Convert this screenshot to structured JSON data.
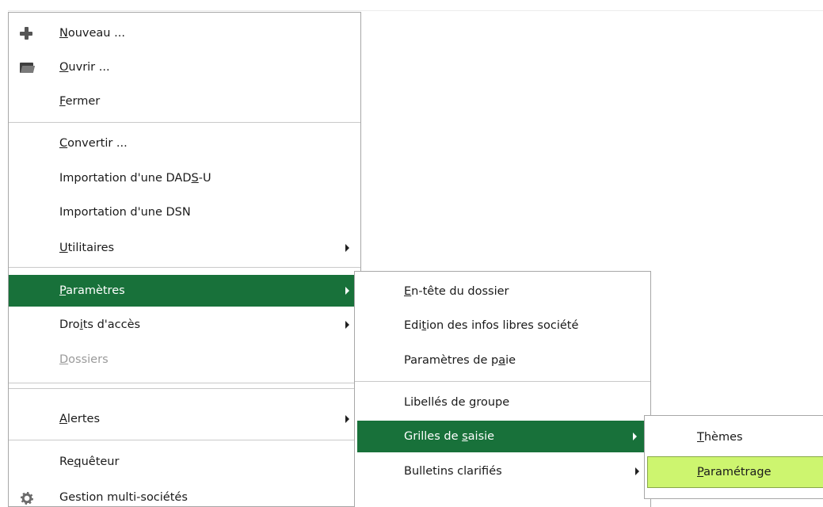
{
  "colors": {
    "selected": "#18713a",
    "hover": "#cdf56f"
  },
  "main_menu": {
    "items": [
      {
        "pre": "",
        "key": "N",
        "post": "ouveau ...",
        "icon": "plus-icon"
      },
      {
        "pre": "",
        "key": "O",
        "post": "uvrir ...",
        "icon": "folder-open-icon"
      },
      {
        "pre": "",
        "key": "F",
        "post": "ermer"
      },
      {
        "pre": "",
        "key": "C",
        "post": "onvertir ..."
      },
      {
        "pre": "Importation d'une DAD",
        "key": "S",
        "post": "-U"
      },
      {
        "pre": "Importation d'une DSN",
        "key": "",
        "post": ""
      },
      {
        "pre": "",
        "key": "U",
        "post": "tilitaires",
        "submenu": true
      },
      {
        "pre": "",
        "key": "P",
        "post": "aramètres",
        "submenu": true,
        "state": "selected"
      },
      {
        "pre": "Dro",
        "key": "i",
        "post": "ts d'accès",
        "submenu": true
      },
      {
        "pre": "",
        "key": "D",
        "post": "ossiers",
        "state": "disabled"
      },
      {
        "pre": "",
        "key": "A",
        "post": "lertes",
        "submenu": true
      },
      {
        "pre": "Re",
        "key": "q",
        "post": "uêteur"
      },
      {
        "pre": "Gestion multi-sociétés",
        "key": "",
        "post": "",
        "icon": "gear-icon"
      }
    ]
  },
  "params_menu": {
    "items": [
      {
        "pre": "",
        "key": "E",
        "post": "n-tête du dossier"
      },
      {
        "pre": "Edi",
        "key": "t",
        "post": "ion des infos libres société"
      },
      {
        "pre": "Paramètres de p",
        "key": "a",
        "post": "ie"
      },
      {
        "pre": "Libellés de ",
        "key": "g",
        "post": "roupe"
      },
      {
        "pre": "Grilles de ",
        "key": "s",
        "post": "aisie",
        "submenu": true,
        "state": "selected"
      },
      {
        "pre": "Bulletins clarifiés",
        "key": "",
        "post": "",
        "submenu": true
      }
    ]
  },
  "grilles_menu": {
    "items": [
      {
        "pre": "",
        "key": "T",
        "post": "hèmes"
      },
      {
        "pre": "",
        "key": "P",
        "post": "aramétrage",
        "state": "hover"
      }
    ]
  }
}
